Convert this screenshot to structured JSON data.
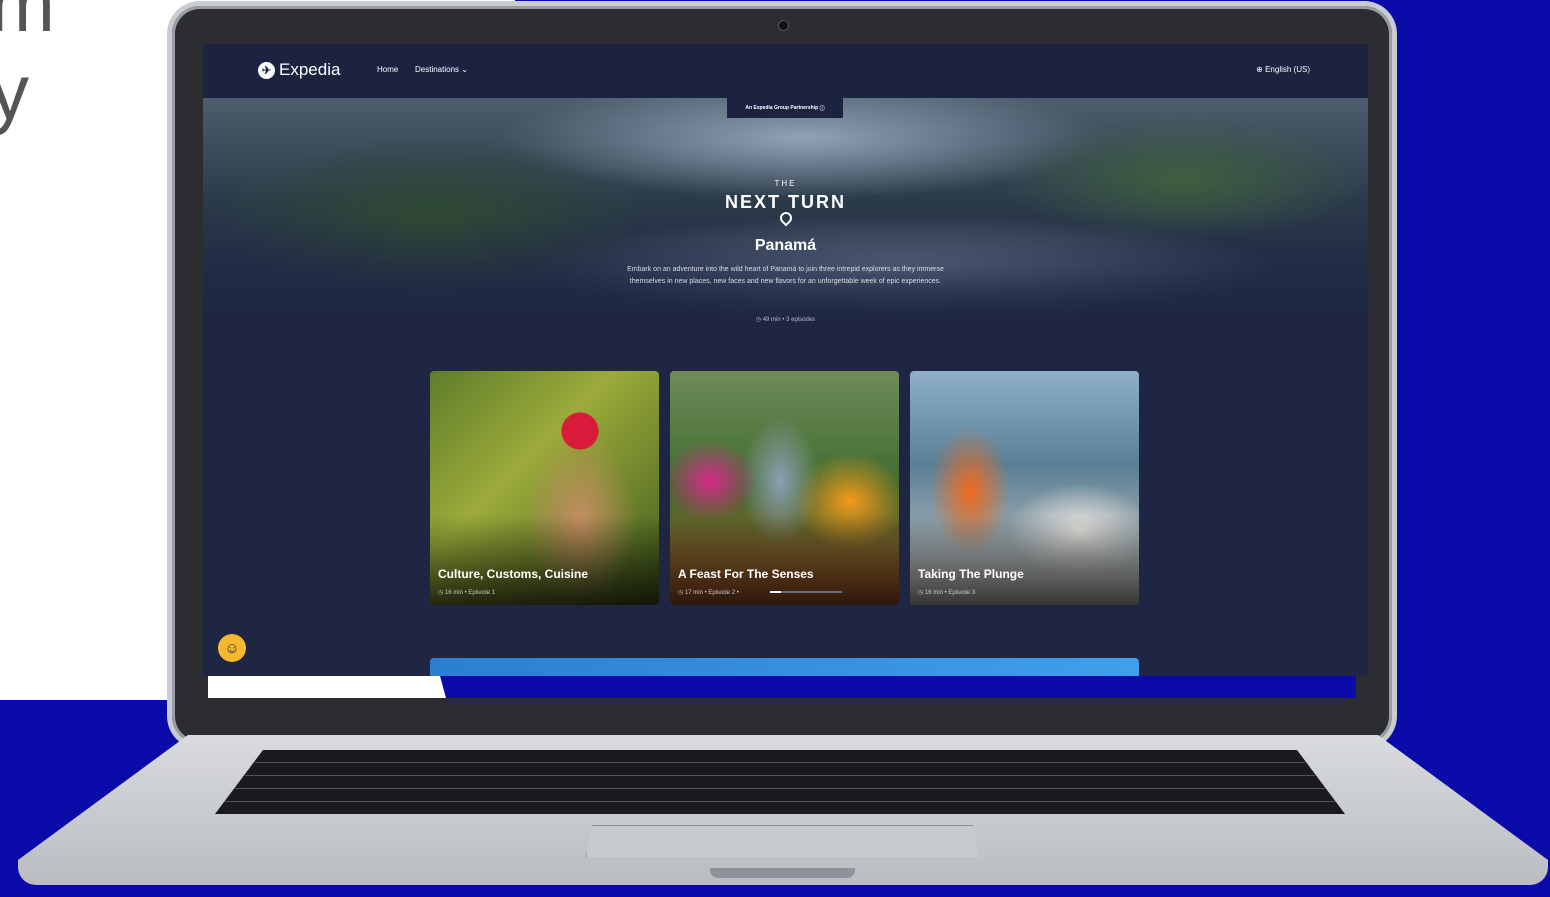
{
  "page": {
    "bigtext_line1": "m",
    "bigtext_line2": "y"
  },
  "site": {
    "brand": "Expedia",
    "nav": {
      "home": "Home",
      "destinations": "Destinations",
      "language": "English (US)"
    },
    "badge": "An Expedia Group Partnership",
    "hero": {
      "the": "THE",
      "show_title": "NEXT TURN",
      "country": "Panamá",
      "description": "Embark on an adventure into the wild heart of Panamá to join three intrepid explorers as they immerse themselves in new places, new faces and new flavors for an unforgettable week of epic experiences.",
      "meta": "49 min  •  3 episodes"
    },
    "episodes": [
      {
        "title": "Culture, Customs, Cuisine",
        "meta": "16 min  •  Episode 1"
      },
      {
        "title": "A Feast For The Senses",
        "meta": "17 min  •  Episode 2  •",
        "progress": 0.15
      },
      {
        "title": "Taking The Plunge",
        "meta": "16 min  •  Episode 3"
      }
    ]
  },
  "colors": {
    "accent_blue": "#0a0ba8",
    "site_bg": "#1e2644",
    "a11y": "#f5b82e"
  },
  "icons": {
    "logo": "expedia-plane-icon",
    "dropdown": "chevron-down-icon",
    "globe": "globe-icon",
    "info": "info-icon",
    "clock": "clock-icon",
    "accessibility": "accessibility-icon"
  }
}
